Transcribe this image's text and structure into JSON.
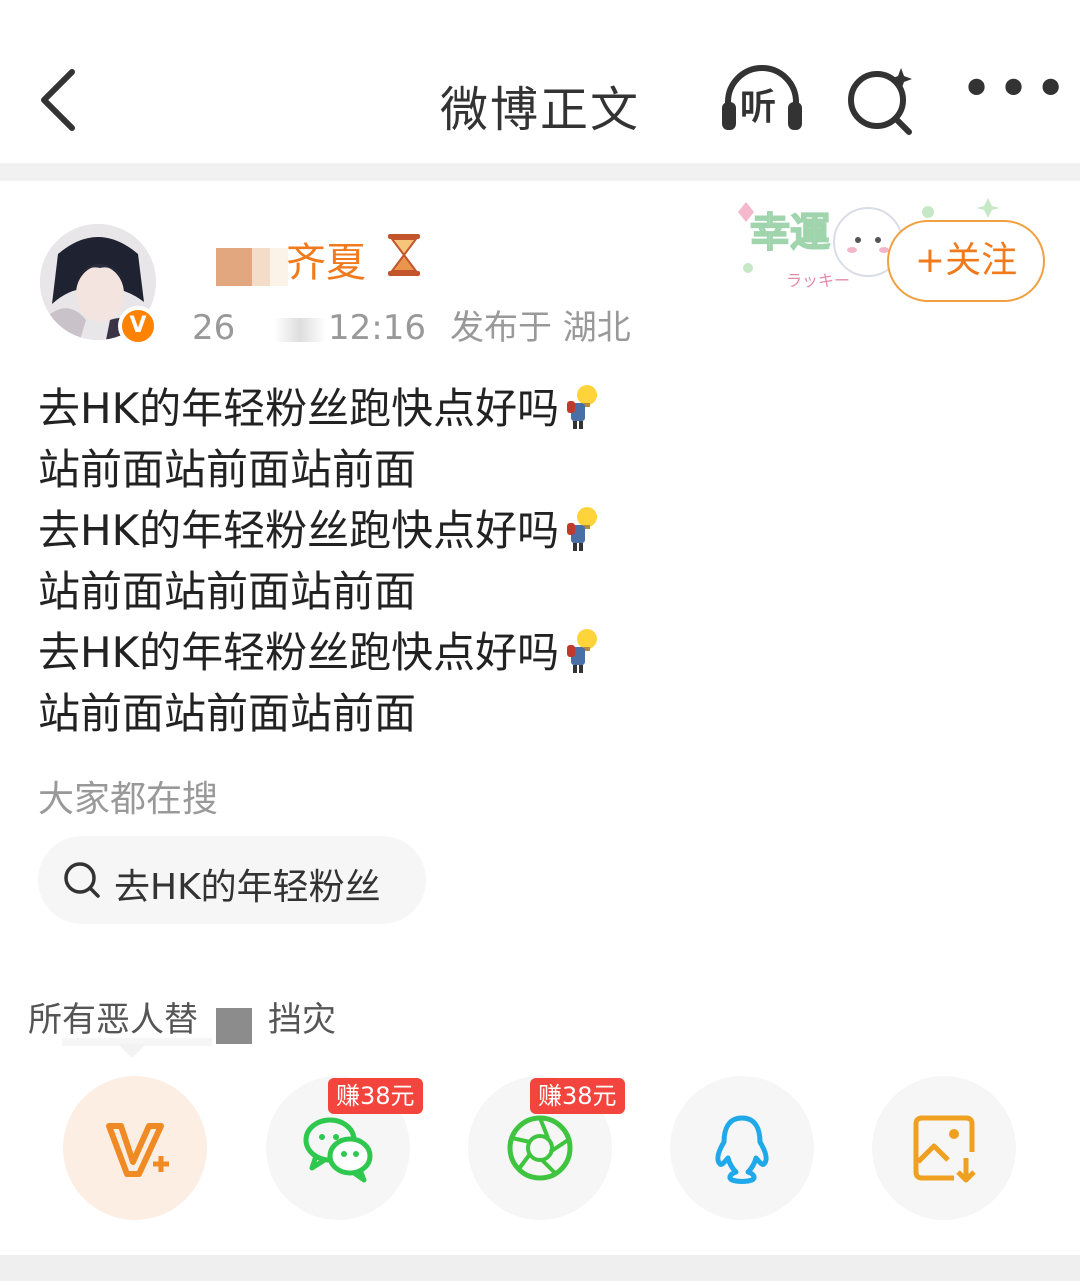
{
  "header": {
    "title": "微博正文",
    "listen_label": "听"
  },
  "user": {
    "name": "齐夏",
    "verified_badge": "V",
    "time_prefix": "26",
    "time": "12:16",
    "published_at": "发布于 湖北",
    "follow_label": "+关注",
    "sticker_text": "幸運",
    "sticker_sub": "ラッキー"
  },
  "post": {
    "lines": [
      "去HK的年轻粉丝跑快点好吗",
      "站前面站前面站前面",
      "去HK的年轻粉丝跑快点好吗",
      "站前面站前面站前面",
      "去HK的年轻粉丝跑快点好吗",
      "站前面站前面站前面"
    ]
  },
  "hot_search": {
    "label": "大家都在搜",
    "chip": "去HK的年轻粉丝"
  },
  "quote": {
    "text_a": "所有恶人替",
    "text_b": "挡灾"
  },
  "share": {
    "badge_wechat": "赚38元",
    "badge_moments": "赚38元",
    "icons": [
      "v-plus-icon",
      "wechat-icon",
      "moments-icon",
      "qq-icon",
      "save-image-icon"
    ]
  },
  "colors": {
    "accent_orange": "#f07a1c",
    "badge_red": "#f3453e",
    "wechat_green": "#2dc84d",
    "qq_blue": "#1fa9ea"
  }
}
